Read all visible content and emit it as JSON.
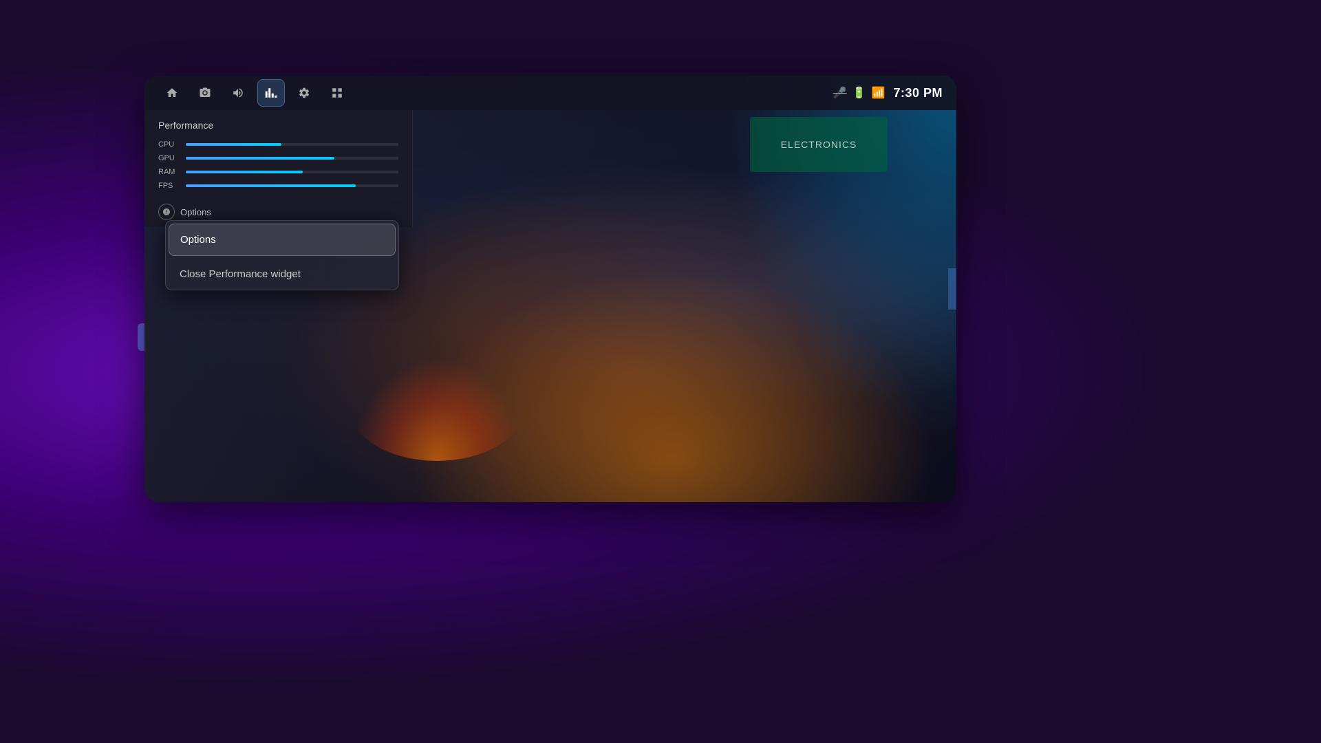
{
  "background": {
    "gradient_left": "#6a0dbc",
    "gradient_right": "#00aaff"
  },
  "nav": {
    "icons": [
      {
        "name": "home",
        "symbol": "⌂",
        "active": false
      },
      {
        "name": "camera",
        "symbol": "📷",
        "active": false
      },
      {
        "name": "volume",
        "symbol": "🔊",
        "active": false
      },
      {
        "name": "performance",
        "symbol": "📊",
        "active": true
      },
      {
        "name": "settings",
        "symbol": "⚙",
        "active": false
      },
      {
        "name": "grid",
        "symbol": "⊞",
        "active": false
      }
    ],
    "status": {
      "mic": "🎤",
      "battery": "🔋",
      "wifi": "📶",
      "time": "7:30 PM"
    }
  },
  "performance_panel": {
    "title": "Performance",
    "rows": [
      {
        "label": "CPU",
        "value": 45
      },
      {
        "label": "GPU",
        "value": 70
      },
      {
        "label": "RAM",
        "value": 55
      },
      {
        "label": "FPS",
        "value": 80
      }
    ],
    "options_button": "Options"
  },
  "context_menu": {
    "items": [
      {
        "label": "Options",
        "highlighted": true
      },
      {
        "label": "Close Performance widget",
        "highlighted": false
      }
    ]
  },
  "game_bg": {
    "store_sign": "ELECTRONICS"
  }
}
